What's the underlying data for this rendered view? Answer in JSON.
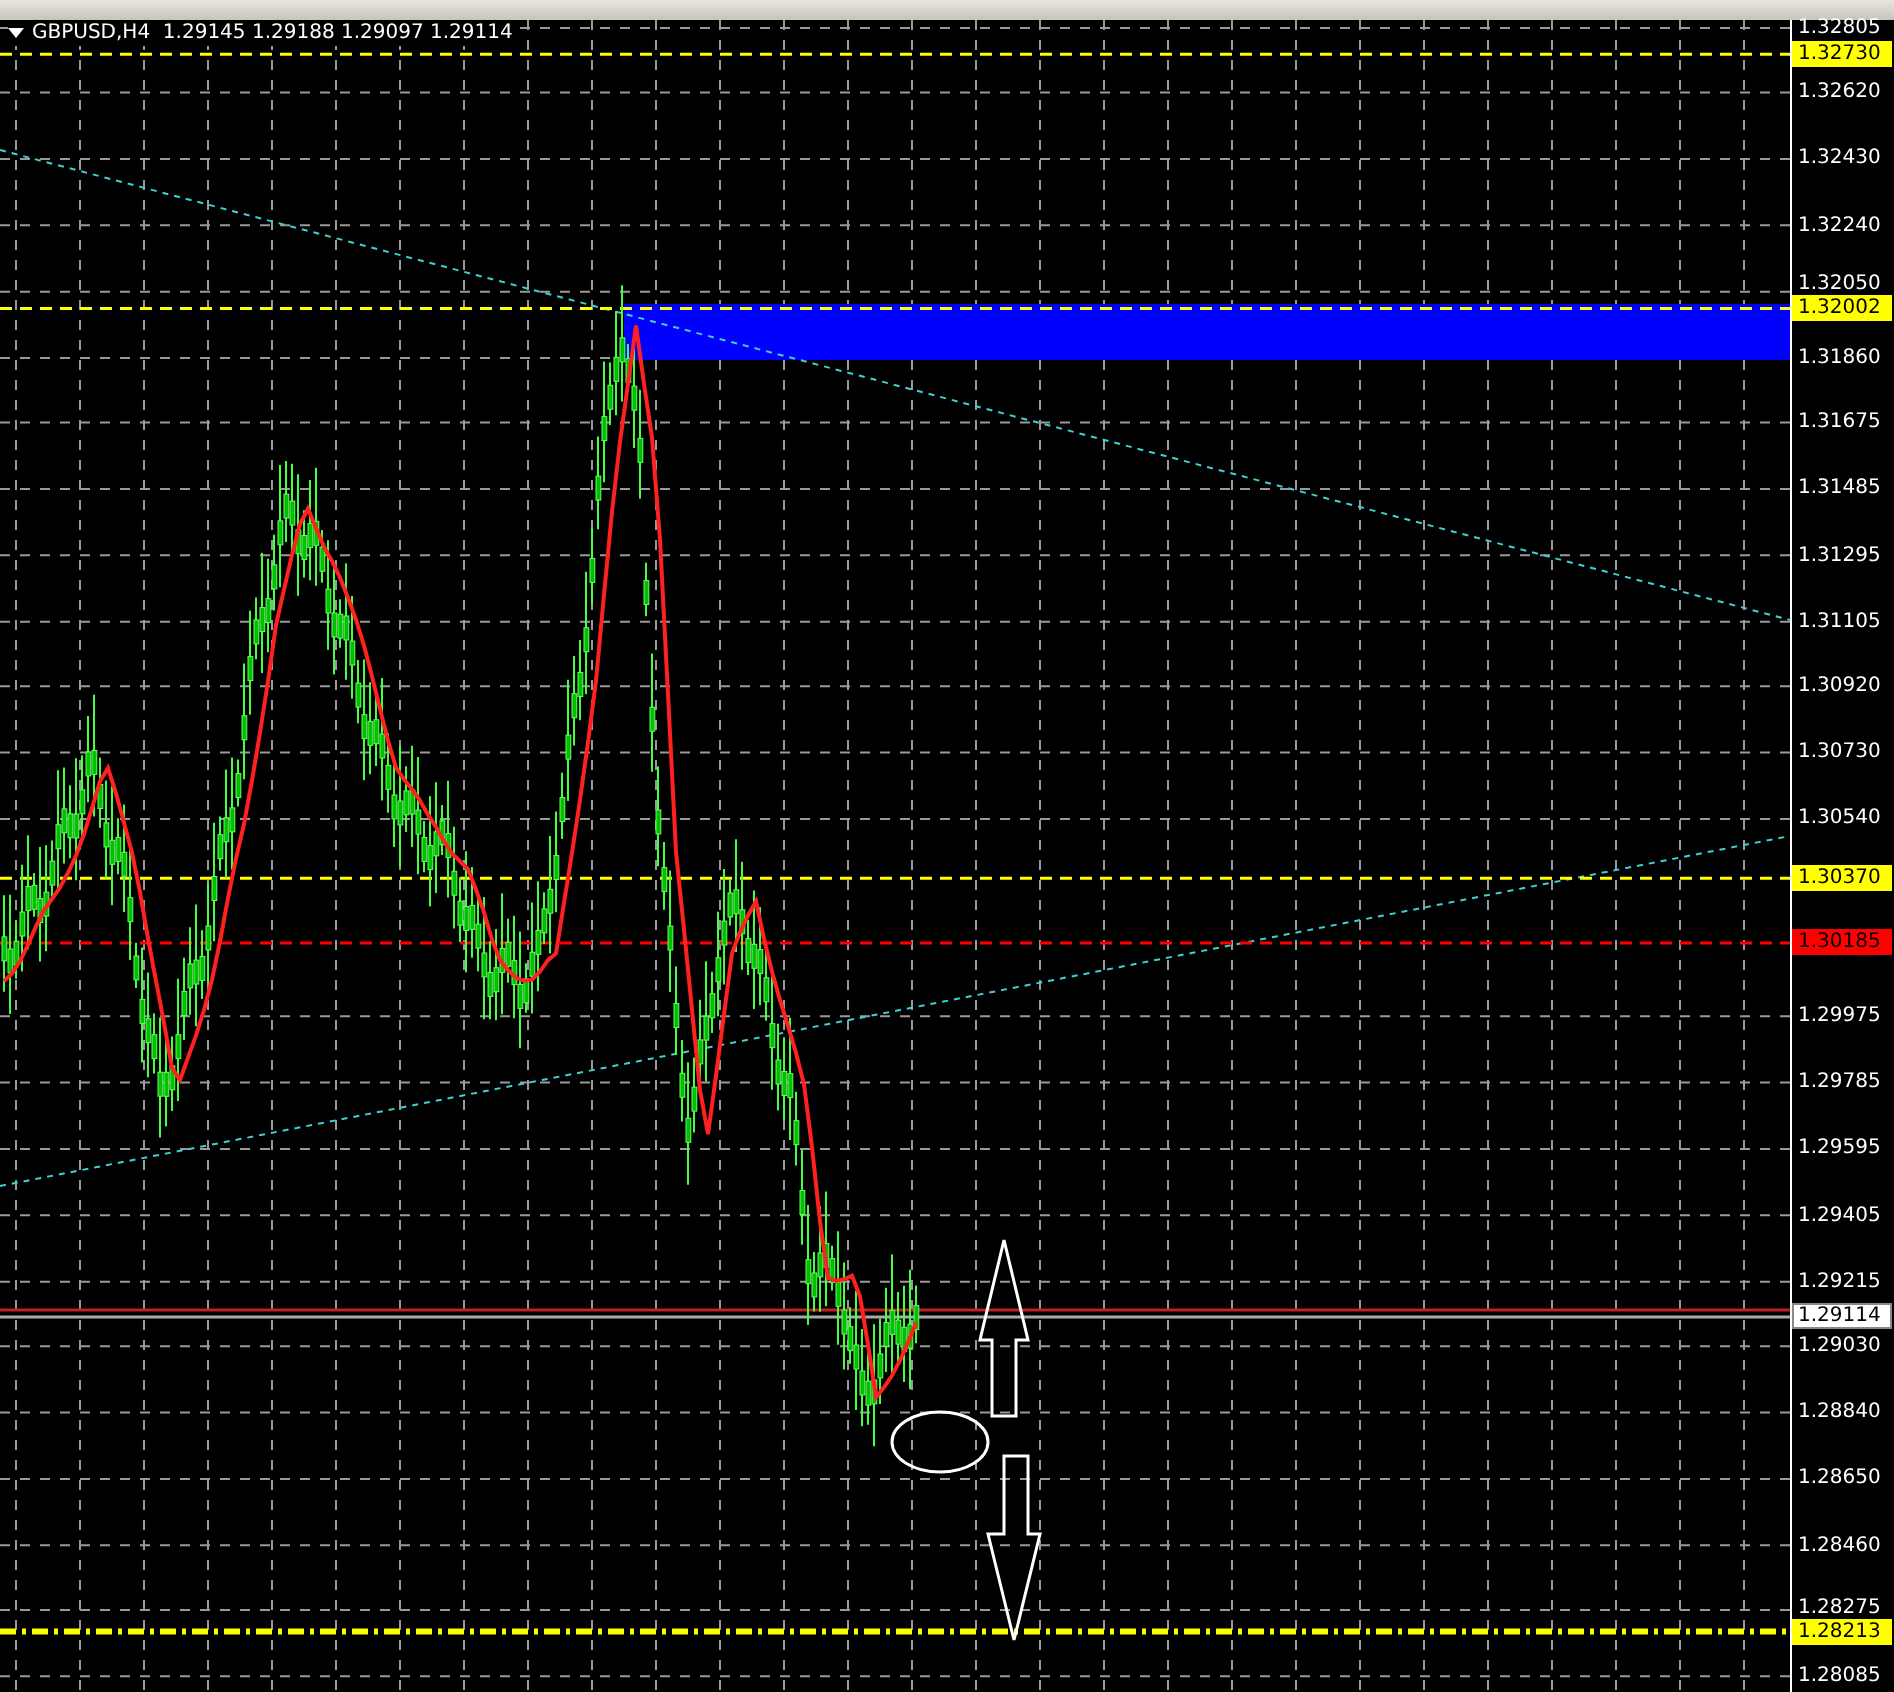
{
  "chart": {
    "header": "GBPUSD,H4  1.29145 1.29188 1.29097 1.29114"
  },
  "price_axis": {
    "ticks": [
      "1.32805",
      "1.32620",
      "1.32430",
      "1.32240",
      "1.32050",
      "1.31860",
      "1.31675",
      "1.31485",
      "1.31295",
      "1.31105",
      "1.30920",
      "1.30730",
      "1.30540",
      "1.29975",
      "1.29785",
      "1.29595",
      "1.29405",
      "1.29215",
      "1.29030",
      "1.28840",
      "1.28650",
      "1.28460",
      "1.28275",
      "1.28085"
    ],
    "markers": [
      {
        "price": "1.32730",
        "color": "#ffff00",
        "kind": "dashed"
      },
      {
        "price": "1.32002",
        "color": "#ffff00",
        "kind": "dashed"
      },
      {
        "price": "1.30370",
        "color": "#ffff00",
        "kind": "dashed"
      },
      {
        "price": "1.30185",
        "color": "#ff0000",
        "kind": "dashed"
      },
      {
        "price": "1.29114",
        "color": "#ffffff",
        "kind": "solid"
      },
      {
        "price": "1.28213",
        "color": "#ffff00",
        "kind": "dashdot"
      }
    ]
  }
}
